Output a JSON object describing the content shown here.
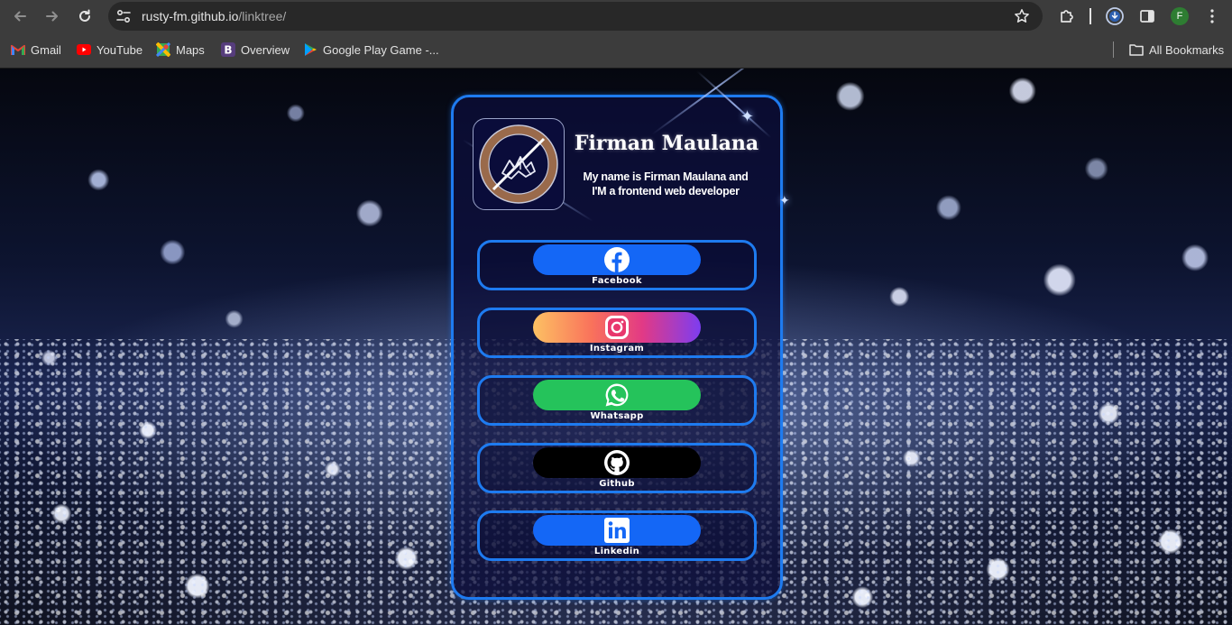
{
  "browser": {
    "url_host": "rusty-fm.github.io",
    "url_path": "/linktree/",
    "profile_initial": "F",
    "bookmarks": [
      {
        "label": "Gmail",
        "icon": "gmail-icon"
      },
      {
        "label": "YouTube",
        "icon": "youtube-icon"
      },
      {
        "label": "Maps",
        "icon": "maps-icon"
      },
      {
        "label": "Overview",
        "icon": "bootstrap-icon"
      },
      {
        "label": "Google Play Game -...",
        "icon": "google-play-icon"
      }
    ],
    "all_bookmarks_label": "All Bookmarks"
  },
  "profile": {
    "name": "Firman Maulana",
    "bio": "My name is Firman Maulana and I'M a frontend web developer"
  },
  "links": [
    {
      "label": "Facebook",
      "icon": "facebook-icon",
      "color": "#1467f6"
    },
    {
      "label": "Instagram",
      "icon": "instagram-icon",
      "color": "#f9a545"
    },
    {
      "label": "Whatsapp",
      "icon": "whatsapp-icon",
      "color": "#25c35b"
    },
    {
      "label": "Github",
      "icon": "github-icon",
      "color": "#000000"
    },
    {
      "label": "Linkedin",
      "icon": "linkedin-icon",
      "color": "#1467f6"
    }
  ],
  "theme": {
    "accent": "#1e7bf0",
    "card_background": "#0c0e3c"
  }
}
